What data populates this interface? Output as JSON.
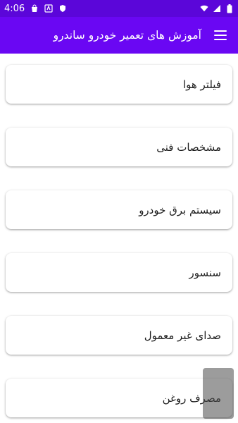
{
  "status_bar": {
    "time": "4:06"
  },
  "app_bar": {
    "title": "آموزش های تعمیر خودرو ساندرو"
  },
  "menu_items": [
    {
      "label": "فیلتر هوا"
    },
    {
      "label": "مشخصات فنی"
    },
    {
      "label": "سیستم برق خودرو"
    },
    {
      "label": "سنسور"
    },
    {
      "label": "صدای غیر معمول"
    },
    {
      "label": "مصرف روغن"
    }
  ],
  "colors": {
    "status_bar": "#5b06d9",
    "app_bar": "#6a07f3",
    "card_bg": "#ffffff"
  }
}
